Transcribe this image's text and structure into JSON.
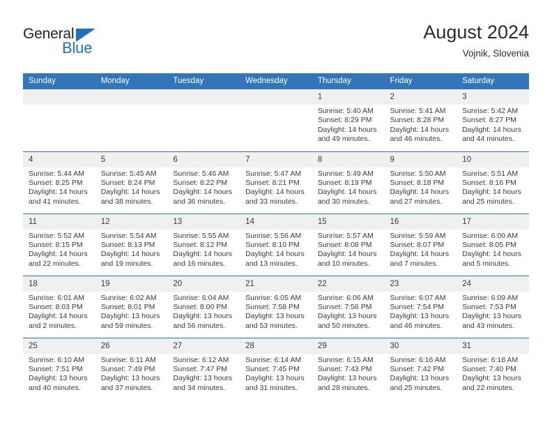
{
  "logo": {
    "word_one": "General",
    "word_two": "Blue",
    "triangle_color": "#1b74bb",
    "text_color": "#231f20"
  },
  "header": {
    "title": "August 2024",
    "subtitle": "Vojnik, Slovenia"
  },
  "theme": {
    "header_bg": "#3275b8",
    "header_text": "#ffffff",
    "daynum_bg": "#f0f0f0",
    "body_text": "#3a3a3a",
    "page_bg": "#ffffff"
  },
  "weekday_headers": [
    "Sunday",
    "Monday",
    "Tuesday",
    "Wednesday",
    "Thursday",
    "Friday",
    "Saturday"
  ],
  "labels": {
    "sunrise_prefix": "Sunrise:",
    "sunset_prefix": "Sunset:",
    "daylight_prefix": "Daylight:"
  },
  "weeks": [
    [
      {
        "day": "",
        "empty": true,
        "line1": "",
        "line2": "",
        "line3": "",
        "line4": ""
      },
      {
        "day": "",
        "empty": true,
        "line1": "",
        "line2": "",
        "line3": "",
        "line4": ""
      },
      {
        "day": "",
        "empty": true,
        "line1": "",
        "line2": "",
        "line3": "",
        "line4": ""
      },
      {
        "day": "",
        "empty": true,
        "line1": "",
        "line2": "",
        "line3": "",
        "line4": ""
      },
      {
        "day": "1",
        "empty": false,
        "line1": "Sunrise: 5:40 AM",
        "line2": "Sunset: 8:29 PM",
        "line3": "Daylight: 14 hours",
        "line4": "and 49 minutes."
      },
      {
        "day": "2",
        "empty": false,
        "line1": "Sunrise: 5:41 AM",
        "line2": "Sunset: 8:28 PM",
        "line3": "Daylight: 14 hours",
        "line4": "and 46 minutes."
      },
      {
        "day": "3",
        "empty": false,
        "line1": "Sunrise: 5:42 AM",
        "line2": "Sunset: 8:27 PM",
        "line3": "Daylight: 14 hours",
        "line4": "and 44 minutes."
      }
    ],
    [
      {
        "day": "4",
        "empty": false,
        "line1": "Sunrise: 5:44 AM",
        "line2": "Sunset: 8:25 PM",
        "line3": "Daylight: 14 hours",
        "line4": "and 41 minutes."
      },
      {
        "day": "5",
        "empty": false,
        "line1": "Sunrise: 5:45 AM",
        "line2": "Sunset: 8:24 PM",
        "line3": "Daylight: 14 hours",
        "line4": "and 38 minutes."
      },
      {
        "day": "6",
        "empty": false,
        "line1": "Sunrise: 5:46 AM",
        "line2": "Sunset: 8:22 PM",
        "line3": "Daylight: 14 hours",
        "line4": "and 36 minutes."
      },
      {
        "day": "7",
        "empty": false,
        "line1": "Sunrise: 5:47 AM",
        "line2": "Sunset: 8:21 PM",
        "line3": "Daylight: 14 hours",
        "line4": "and 33 minutes."
      },
      {
        "day": "8",
        "empty": false,
        "line1": "Sunrise: 5:49 AM",
        "line2": "Sunset: 8:19 PM",
        "line3": "Daylight: 14 hours",
        "line4": "and 30 minutes."
      },
      {
        "day": "9",
        "empty": false,
        "line1": "Sunrise: 5:50 AM",
        "line2": "Sunset: 8:18 PM",
        "line3": "Daylight: 14 hours",
        "line4": "and 27 minutes."
      },
      {
        "day": "10",
        "empty": false,
        "line1": "Sunrise: 5:51 AM",
        "line2": "Sunset: 8:16 PM",
        "line3": "Daylight: 14 hours",
        "line4": "and 25 minutes."
      }
    ],
    [
      {
        "day": "11",
        "empty": false,
        "line1": "Sunrise: 5:52 AM",
        "line2": "Sunset: 8:15 PM",
        "line3": "Daylight: 14 hours",
        "line4": "and 22 minutes."
      },
      {
        "day": "12",
        "empty": false,
        "line1": "Sunrise: 5:54 AM",
        "line2": "Sunset: 8:13 PM",
        "line3": "Daylight: 14 hours",
        "line4": "and 19 minutes."
      },
      {
        "day": "13",
        "empty": false,
        "line1": "Sunrise: 5:55 AM",
        "line2": "Sunset: 8:12 PM",
        "line3": "Daylight: 14 hours",
        "line4": "and 16 minutes."
      },
      {
        "day": "14",
        "empty": false,
        "line1": "Sunrise: 5:56 AM",
        "line2": "Sunset: 8:10 PM",
        "line3": "Daylight: 14 hours",
        "line4": "and 13 minutes."
      },
      {
        "day": "15",
        "empty": false,
        "line1": "Sunrise: 5:57 AM",
        "line2": "Sunset: 8:08 PM",
        "line3": "Daylight: 14 hours",
        "line4": "and 10 minutes."
      },
      {
        "day": "16",
        "empty": false,
        "line1": "Sunrise: 5:59 AM",
        "line2": "Sunset: 8:07 PM",
        "line3": "Daylight: 14 hours",
        "line4": "and 7 minutes."
      },
      {
        "day": "17",
        "empty": false,
        "line1": "Sunrise: 6:00 AM",
        "line2": "Sunset: 8:05 PM",
        "line3": "Daylight: 14 hours",
        "line4": "and 5 minutes."
      }
    ],
    [
      {
        "day": "18",
        "empty": false,
        "line1": "Sunrise: 6:01 AM",
        "line2": "Sunset: 8:03 PM",
        "line3": "Daylight: 14 hours",
        "line4": "and 2 minutes."
      },
      {
        "day": "19",
        "empty": false,
        "line1": "Sunrise: 6:02 AM",
        "line2": "Sunset: 8:01 PM",
        "line3": "Daylight: 13 hours",
        "line4": "and 59 minutes."
      },
      {
        "day": "20",
        "empty": false,
        "line1": "Sunrise: 6:04 AM",
        "line2": "Sunset: 8:00 PM",
        "line3": "Daylight: 13 hours",
        "line4": "and 56 minutes."
      },
      {
        "day": "21",
        "empty": false,
        "line1": "Sunrise: 6:05 AM",
        "line2": "Sunset: 7:58 PM",
        "line3": "Daylight: 13 hours",
        "line4": "and 53 minutes."
      },
      {
        "day": "22",
        "empty": false,
        "line1": "Sunrise: 6:06 AM",
        "line2": "Sunset: 7:56 PM",
        "line3": "Daylight: 13 hours",
        "line4": "and 50 minutes."
      },
      {
        "day": "23",
        "empty": false,
        "line1": "Sunrise: 6:07 AM",
        "line2": "Sunset: 7:54 PM",
        "line3": "Daylight: 13 hours",
        "line4": "and 46 minutes."
      },
      {
        "day": "24",
        "empty": false,
        "line1": "Sunrise: 6:09 AM",
        "line2": "Sunset: 7:53 PM",
        "line3": "Daylight: 13 hours",
        "line4": "and 43 minutes."
      }
    ],
    [
      {
        "day": "25",
        "empty": false,
        "line1": "Sunrise: 6:10 AM",
        "line2": "Sunset: 7:51 PM",
        "line3": "Daylight: 13 hours",
        "line4": "and 40 minutes."
      },
      {
        "day": "26",
        "empty": false,
        "line1": "Sunrise: 6:11 AM",
        "line2": "Sunset: 7:49 PM",
        "line3": "Daylight: 13 hours",
        "line4": "and 37 minutes."
      },
      {
        "day": "27",
        "empty": false,
        "line1": "Sunrise: 6:12 AM",
        "line2": "Sunset: 7:47 PM",
        "line3": "Daylight: 13 hours",
        "line4": "and 34 minutes."
      },
      {
        "day": "28",
        "empty": false,
        "line1": "Sunrise: 6:14 AM",
        "line2": "Sunset: 7:45 PM",
        "line3": "Daylight: 13 hours",
        "line4": "and 31 minutes."
      },
      {
        "day": "29",
        "empty": false,
        "line1": "Sunrise: 6:15 AM",
        "line2": "Sunset: 7:43 PM",
        "line3": "Daylight: 13 hours",
        "line4": "and 28 minutes."
      },
      {
        "day": "30",
        "empty": false,
        "line1": "Sunrise: 6:16 AM",
        "line2": "Sunset: 7:42 PM",
        "line3": "Daylight: 13 hours",
        "line4": "and 25 minutes."
      },
      {
        "day": "31",
        "empty": false,
        "line1": "Sunrise: 6:18 AM",
        "line2": "Sunset: 7:40 PM",
        "line3": "Daylight: 13 hours",
        "line4": "and 22 minutes."
      }
    ]
  ]
}
